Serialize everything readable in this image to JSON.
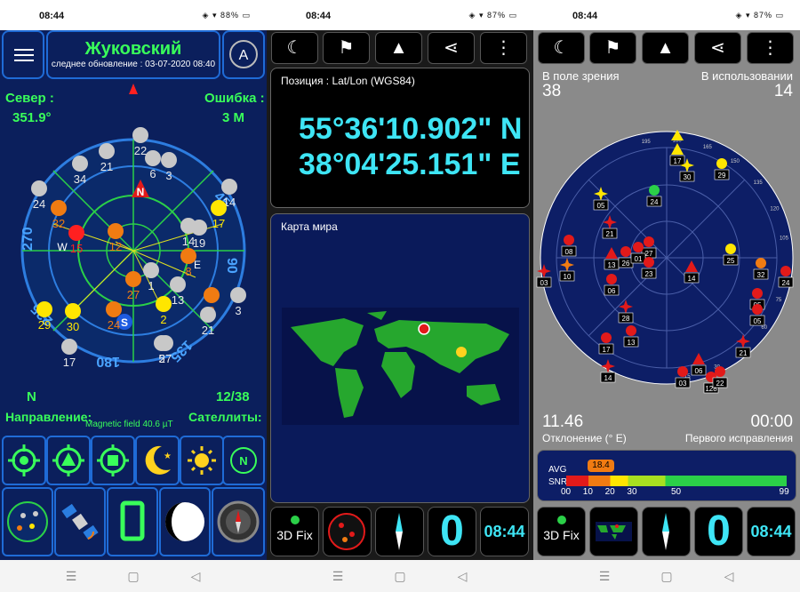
{
  "status": {
    "time": "08:44",
    "battery_left": "88%",
    "battery_mid": "87%",
    "battery_right": "87%"
  },
  "panel1": {
    "city": "Жуковский",
    "last_update": "следнее обновление : 03-07-2020 08:40",
    "north_label": "Север :",
    "north_value": "351.9°",
    "error_label": "Ошибка :",
    "error_value": "3 M",
    "direction_letter": "N",
    "sat_count": "12/38",
    "direction_label": "Направление:",
    "satellites_label": "Сателлиты:",
    "magnetic": "Magnetic field 40.6 µT",
    "radar_labels": {
      "n": "N",
      "s": "S",
      "w": "W",
      "e": "E",
      "d270": "270",
      "d45": "45",
      "d90": "90",
      "d180": "180",
      "d135": "135",
      "d225": "225"
    },
    "sats": [
      {
        "id": "21",
        "c": "#c8c8c8"
      },
      {
        "id": "22",
        "c": "#c8c8c8"
      },
      {
        "id": "6",
        "c": "#c8c8c8"
      },
      {
        "id": "3",
        "c": "#c8c8c8"
      },
      {
        "id": "34",
        "c": "#c8c8c8"
      },
      {
        "id": "24",
        "c": "#c8c8c8"
      },
      {
        "id": "32",
        "c": "#f07b12"
      },
      {
        "id": "14",
        "c": "#c8c8c8"
      },
      {
        "id": "17",
        "c": "#ffe600"
      },
      {
        "id": "19",
        "c": "#c8c8c8"
      },
      {
        "id": "15",
        "c": "#ff2020"
      },
      {
        "id": "14",
        "c": "#c8c8c8"
      },
      {
        "id": "12",
        "c": "#f07b12"
      },
      {
        "id": "8",
        "c": "#f07b12"
      },
      {
        "id": "1",
        "c": "#c8c8c8"
      },
      {
        "id": "27",
        "c": "#f07b12"
      },
      {
        "id": "13",
        "c": "#c8c8c8"
      },
      {
        "id": "0",
        "c": "#f07b12"
      },
      {
        "id": "3",
        "c": "#c8c8c8"
      },
      {
        "id": "29",
        "c": "#ffe600"
      },
      {
        "id": "30",
        "c": "#ffe600"
      },
      {
        "id": "24",
        "c": "#f07b12"
      },
      {
        "id": "2",
        "c": "#ffe600"
      },
      {
        "id": "21",
        "c": "#c8c8c8"
      },
      {
        "id": "5",
        "c": "#c8c8c8"
      },
      {
        "id": "27",
        "c": "#c8c8c8"
      },
      {
        "id": "17",
        "c": "#c8c8c8"
      }
    ]
  },
  "panel2": {
    "position_title": "Позиция : Lat/Lon (WGS84)",
    "lat": "55°36'10.902\" N",
    "lon": "38°04'25.151\" E",
    "map_title": "Карта мира",
    "fix_label": "3D Fix",
    "fix_count": "0",
    "clock": "08:44"
  },
  "panel3": {
    "in_view_label": "В поле зрения",
    "in_view": "38",
    "in_use_label": "В использовании",
    "in_use": "14",
    "declination": "11.46",
    "declination_label": "Отклонение (° E)",
    "first_fix": "00:00",
    "first_fix_label": "Первого исправления",
    "avg_label": "AVG",
    "snr_label": "SNR",
    "avg_value": "18.4",
    "snr_ticks": [
      "00",
      "10",
      "20",
      "30",
      "50",
      "99"
    ],
    "fix_label": "3D Fix",
    "fix_count": "0",
    "clock": "08:44",
    "sky_ticks": [
      "195",
      "180",
      "165",
      "150",
      "135",
      "120",
      "105",
      "90",
      "75",
      "60",
      "45",
      "30",
      "15"
    ],
    "sats": [
      {
        "id": "17"
      },
      {
        "id": "30"
      },
      {
        "id": "29"
      },
      {
        "id": "05"
      },
      {
        "id": "24"
      },
      {
        "id": "21"
      },
      {
        "id": "13"
      },
      {
        "id": "27"
      },
      {
        "id": "26"
      },
      {
        "id": "01"
      },
      {
        "id": "23"
      },
      {
        "id": "10"
      },
      {
        "id": "03"
      },
      {
        "id": "06"
      },
      {
        "id": "28"
      },
      {
        "id": "13"
      },
      {
        "id": "14"
      },
      {
        "id": "25"
      },
      {
        "id": "32"
      },
      {
        "id": "24"
      },
      {
        "id": "05"
      },
      {
        "id": "05"
      },
      {
        "id": "21"
      },
      {
        "id": "17"
      },
      {
        "id": "14"
      },
      {
        "id": "06"
      },
      {
        "id": "03"
      },
      {
        "id": "128"
      },
      {
        "id": "22"
      },
      {
        "id": "08"
      }
    ]
  }
}
